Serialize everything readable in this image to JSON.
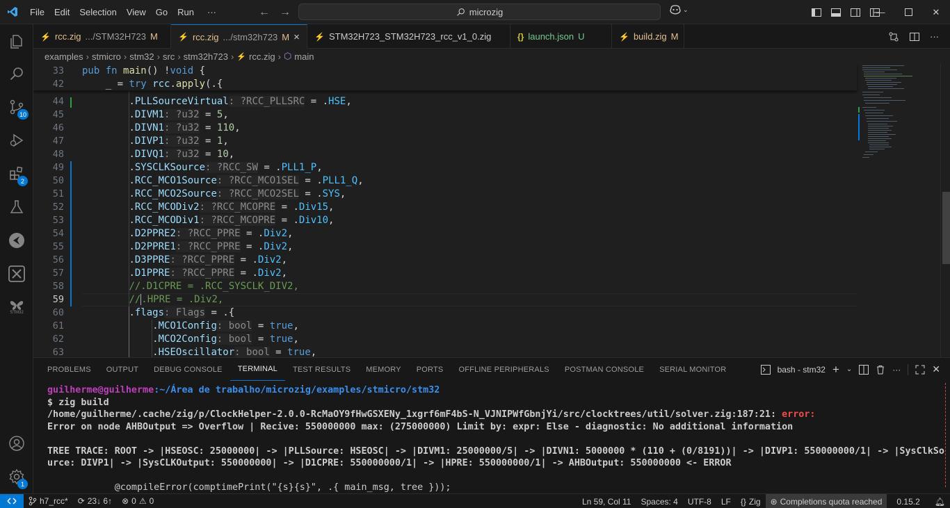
{
  "titlebar": {
    "menu": [
      "File",
      "Edit",
      "Selection",
      "View",
      "Go",
      "Run",
      "···"
    ],
    "search": "microzig"
  },
  "tabs": [
    {
      "name": "rcc.zig",
      "desc": ".../STM32H723",
      "status": "M",
      "icon": "zig"
    },
    {
      "name": "rcc.zig",
      "desc": ".../stm32h723",
      "status": "M",
      "icon": "zig",
      "close": "×"
    },
    {
      "name": "STM32H723_STM32H723_rcc_v1_0.zig",
      "desc": "",
      "status": "",
      "icon": "zig"
    },
    {
      "name": "launch.json",
      "desc": "",
      "status": "U",
      "icon": "json"
    },
    {
      "name": "build.zig",
      "desc": "",
      "status": "M",
      "icon": "zig"
    }
  ],
  "breadcrumb": [
    "examples",
    "stmicro",
    "stm32",
    "src",
    "stm32h723",
    "rcc.zig",
    "main"
  ],
  "activity_badges": {
    "source_control": "10",
    "run_debug": "2",
    "manage": "1"
  },
  "activity_labels": {
    "stm32": "STM32"
  },
  "editor": {
    "sticky": [
      {
        "n": "33"
      },
      {
        "n": "42"
      }
    ],
    "lines": [
      {
        "n": "44"
      },
      {
        "n": "45"
      },
      {
        "n": "46"
      },
      {
        "n": "47"
      },
      {
        "n": "48"
      },
      {
        "n": "49"
      },
      {
        "n": "50"
      },
      {
        "n": "51"
      },
      {
        "n": "52"
      },
      {
        "n": "53"
      },
      {
        "n": "54"
      },
      {
        "n": "55"
      },
      {
        "n": "56"
      },
      {
        "n": "57"
      },
      {
        "n": "58"
      },
      {
        "n": "59"
      },
      {
        "n": "60"
      },
      {
        "n": "61"
      },
      {
        "n": "62"
      },
      {
        "n": "63"
      }
    ]
  },
  "panel": {
    "tabs": [
      "PROBLEMS",
      "OUTPUT",
      "DEBUG CONSOLE",
      "TERMINAL",
      "TEST RESULTS",
      "MEMORY",
      "PORTS",
      "OFFLINE PERIPHERALS",
      "POSTMAN CONSOLE",
      "SERIAL MONITOR"
    ],
    "active_tab": "TERMINAL",
    "terminal_name": "bash - stm32",
    "terminal": {
      "user": "guilherme@guilherme",
      "path": ":~/Área de trabalho/microzig/examples/stmicro/stm32",
      "cmd": "$ zig build",
      "err_path": "/home/guilherme/.cache/zig/p/ClockHelper-2.0.0-RcMaOY9fHwGSXENy_1xgrf6mF4bS-N_VJNIPWfGbnjYi/src/clocktrees/util/solver.zig:187:21: ",
      "err_label": "error:",
      "err_msg": "Error on node AHBOutput => Overflow | Recive: 550000000 max: (275000000) Limit by: expr: Else - diagnostic: No additional information",
      "trace1": "TREE TRACE: ROOT -> |HSEOSC: 25000000| -> |PLLSource: HSEOSC| -> |DIVM1: 25000000/5| -> |DIVN1: 5000000 * (110 + (0/8191))| -> |DIVP1: 550000000/1| -> |SysClkSo",
      "trace2": "urce: DIVP1| -> |SysCLKOutput: 550000000| -> |D1CPRE: 550000000/1| -> |HPRE: 550000000/1| -> AHBOutput: 550000000 <- ERROR",
      "compile": "            @compileError(comptimePrint(\"{s}{s}\", .{ main_msg, tree }));"
    }
  },
  "statusbar": {
    "branch": "h7_rcc*",
    "sync": "23↓ 6↑",
    "errors": "0",
    "warnings": "0",
    "position": "Ln 59, Col 11",
    "spaces": "Spaces: 4",
    "encoding": "UTF-8",
    "eol": "LF",
    "language": "Zig",
    "copilot": "Completions quota reached",
    "version": "0.15.2"
  },
  "colors": {
    "accent": "#0078d4",
    "zig": "#f7a41d",
    "bg": "#1f1f1f"
  }
}
